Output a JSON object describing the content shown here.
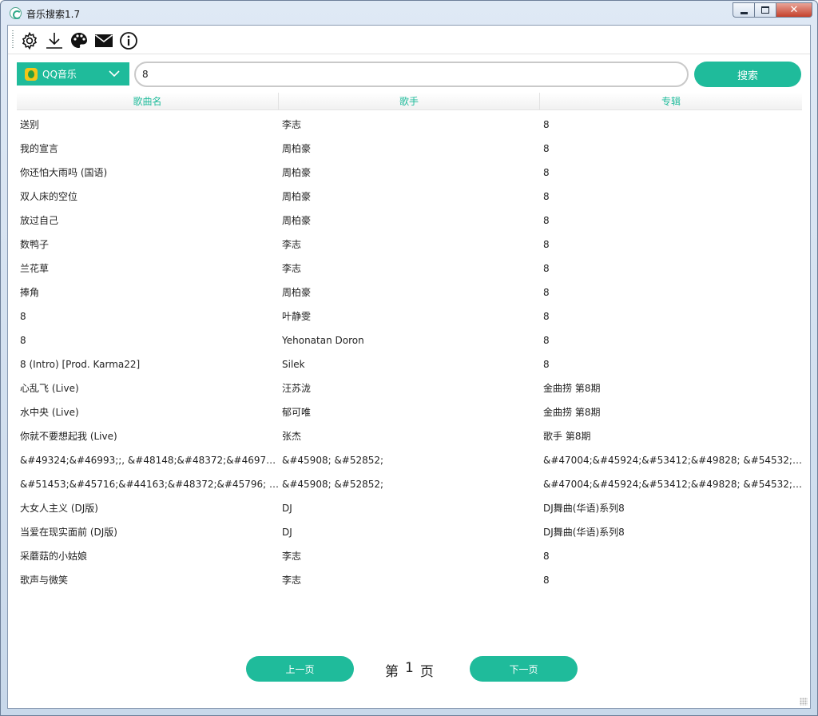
{
  "window": {
    "title": "音乐搜索1.7",
    "controls": {
      "minimize": "minimize",
      "maximize": "maximize",
      "close": "✕"
    }
  },
  "toolbar": {
    "icons": [
      "gear-icon",
      "download-icon",
      "palette-icon",
      "mail-icon",
      "info-icon"
    ]
  },
  "search": {
    "source": "QQ音乐",
    "query": "8",
    "button_label": "搜索"
  },
  "table": {
    "columns": [
      "歌曲名",
      "歌手",
      "专辑"
    ],
    "rows": [
      [
        "送别",
        "李志",
        "8"
      ],
      [
        "我的宣言",
        "周柏豪",
        "8"
      ],
      [
        "你还怕大雨吗 (国语)",
        "周柏豪",
        "8"
      ],
      [
        "双人床的空位",
        "周柏豪",
        "8"
      ],
      [
        "放过自己",
        "周柏豪",
        "8"
      ],
      [
        "数鸭子",
        "李志",
        "8"
      ],
      [
        "兰花草",
        "李志",
        "8"
      ],
      [
        "捧角",
        "周柏豪",
        "8"
      ],
      [
        "8",
        "叶静雯",
        "8"
      ],
      [
        "8",
        "Yehonatan Doron",
        "8"
      ],
      [
        "8 (Intro) [Prod. Karma22]",
        "Silek",
        "8"
      ],
      [
        "心乱飞 (Live)",
        "汪苏泷",
        "金曲捞 第8期"
      ],
      [
        "水中央 (Live)",
        "郁可唯",
        "金曲捞 第8期"
      ],
      [
        "你就不要想起我 (Live)",
        "张杰",
        "歌手 第8期"
      ],
      [
        "&#49324;&#46993;;, &#48148;&#48372;&#46972;&#...",
        "&#45908; &#52852;",
        "&#47004;&#45924;&#53412;&#49828; &#54532;&#4..."
      ],
      [
        "&#51453;&#45716;&#44163;&#48372;&#45796; (Inst...",
        "&#45908; &#52852;",
        "&#47004;&#45924;&#53412;&#49828; &#54532;&#4..."
      ],
      [
        "大女人主义 (DJ版)",
        "DJ",
        "DJ舞曲(华语)系列8"
      ],
      [
        "当爱在现实面前 (DJ版)",
        "DJ",
        "DJ舞曲(华语)系列8"
      ],
      [
        "采蘑菇的小姑娘",
        "李志",
        "8"
      ],
      [
        "歌声与微笑",
        "李志",
        "8"
      ]
    ]
  },
  "pagination": {
    "prev_label": "上一页",
    "next_label": "下一页",
    "page_prefix": "第",
    "page_number": "1",
    "page_suffix": "页"
  },
  "colors": {
    "accent": "#1fbb9b",
    "header_text": "#1fbb9b"
  }
}
